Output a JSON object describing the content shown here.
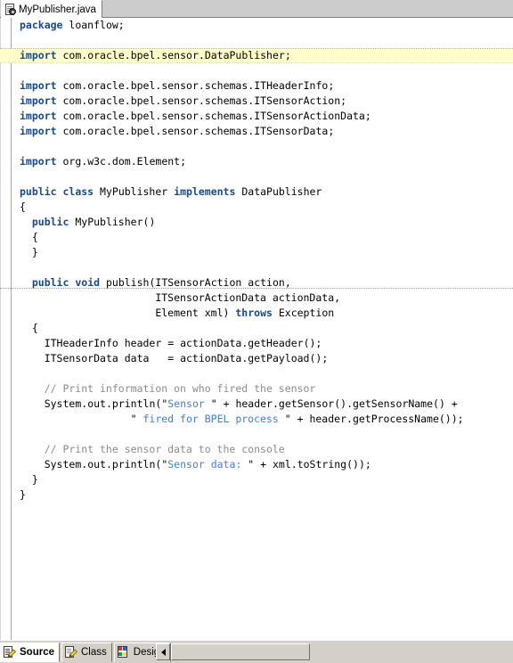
{
  "window": {
    "document_tab": {
      "label": "MyPublisher.java",
      "icon": "java-file-icon"
    }
  },
  "editor": {
    "highlight_color": "#ffffcc",
    "keyword_color": "#174a8a",
    "string_color": "#3f7fd6",
    "comment_color": "#8c8c8c",
    "highlighted_line_index": 2,
    "separator_line_index": 18,
    "lines": [
      {
        "text": "package loanflow;",
        "indent": 0
      },
      {
        "text": "",
        "indent": 0
      },
      {
        "text": "import com.oracle.bpel.sensor.DataPublisher;",
        "indent": 0
      },
      {
        "text": "",
        "indent": 0
      },
      {
        "text": "import com.oracle.bpel.sensor.schemas.ITHeaderInfo;",
        "indent": 0
      },
      {
        "text": "import com.oracle.bpel.sensor.schemas.ITSensorAction;",
        "indent": 0
      },
      {
        "text": "import com.oracle.bpel.sensor.schemas.ITSensorActionData;",
        "indent": 0
      },
      {
        "text": "import com.oracle.bpel.sensor.schemas.ITSensorData;",
        "indent": 0
      },
      {
        "text": "",
        "indent": 0
      },
      {
        "text": "import org.w3c.dom.Element;",
        "indent": 0
      },
      {
        "text": "",
        "indent": 0
      },
      {
        "text": "public class MyPublisher implements DataPublisher",
        "indent": 0
      },
      {
        "text": "{",
        "indent": 0
      },
      {
        "text": "  public MyPublisher()",
        "indent": 2
      },
      {
        "text": "  {",
        "indent": 2
      },
      {
        "text": "  }",
        "indent": 2
      },
      {
        "text": "",
        "indent": 0
      },
      {
        "text": "  public void publish(ITSensorAction action,",
        "indent": 2
      },
      {
        "text": "                      ITSensorActionData actionData,",
        "indent": 22
      },
      {
        "text": "                      Element xml) throws Exception",
        "indent": 22
      },
      {
        "text": "  {",
        "indent": 2
      },
      {
        "text": "    ITHeaderInfo header = actionData.getHeader();",
        "indent": 4
      },
      {
        "text": "    ITSensorData data   = actionData.getPayload();",
        "indent": 4
      },
      {
        "text": "",
        "indent": 0
      },
      {
        "text": "    // Print information on who fired the sensor",
        "indent": 4
      },
      {
        "text": "    System.out.println(\"Sensor \" + header.getSensor().getSensorName() +",
        "indent": 4
      },
      {
        "text": "                  \" fired for BPEL process \" + header.getProcessName());",
        "indent": 18
      },
      {
        "text": "",
        "indent": 0
      },
      {
        "text": "    // Print the sensor data to the console",
        "indent": 4
      },
      {
        "text": "    System.out.println(\"Sensor data: \" + xml.toString());",
        "indent": 4
      },
      {
        "text": "  }",
        "indent": 2
      },
      {
        "text": "}",
        "indent": 0
      }
    ]
  },
  "view_tabs": [
    {
      "label": "Source",
      "icon": "source-icon",
      "active": true
    },
    {
      "label": "Class",
      "icon": "class-icon",
      "active": false
    },
    {
      "label": "Design",
      "icon": "design-icon",
      "active": false
    }
  ],
  "scrollbar": {
    "left_arrow": "◄",
    "thumb_position": "left"
  }
}
